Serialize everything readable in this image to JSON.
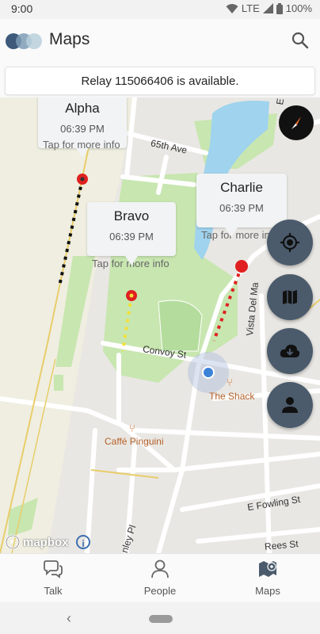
{
  "status_bar": {
    "time": "9:00",
    "network": "LTE",
    "battery": "100%"
  },
  "app_bar": {
    "title": "Maps",
    "search_icon": "search-icon"
  },
  "banner": {
    "text": "Relay 115066406 is available."
  },
  "map": {
    "markers": [
      {
        "name": "Alpha",
        "time": "06:39 PM",
        "hint": "Tap for more info"
      },
      {
        "name": "Bravo",
        "time": "06:39 PM",
        "hint": "Tap for more info"
      },
      {
        "name": "Charlie",
        "time": "06:39 PM",
        "hint": "Tap for more info"
      }
    ],
    "streets": {
      "s1": "65th Ave",
      "s2": "Convoy St",
      "s3": "Vista Del Ma",
      "s4": "E Fowling St",
      "s5": "Rees St",
      "s6": "nley Pl",
      "s7": "E"
    },
    "pois": {
      "p1": "The Shack",
      "p2": "Caffé Pinguini"
    },
    "attribution": {
      "logo": "mapbox"
    },
    "colors": {
      "alpha_trail": "#111111",
      "bravo_trail": "#f2e03a",
      "charlie_trail": "#e02020",
      "marker": "#e02020",
      "fab": "#4b5b6c",
      "water": "#9fd3ee",
      "park": "#c8e6b0"
    }
  },
  "fabs": [
    "location-icon",
    "map-icon",
    "cloud-download-icon",
    "person-icon"
  ],
  "bottom_nav": [
    {
      "label": "Talk",
      "icon": "chat-icon"
    },
    {
      "label": "People",
      "icon": "person-icon"
    },
    {
      "label": "Maps",
      "icon": "map-pin-icon"
    }
  ]
}
